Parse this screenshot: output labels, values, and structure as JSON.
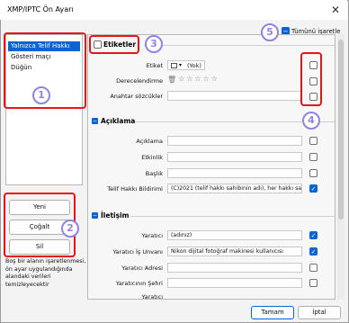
{
  "window": {
    "title": "XMP/IPTC Ön Ayarı"
  },
  "presets": [
    "Yalnızca Telif Hakkı",
    "Gösteri maçı",
    "Düğün"
  ],
  "side_buttons": {
    "new": "Yeni",
    "duplicate": "Çoğalt",
    "delete": "Sil"
  },
  "hint": "Boş bir alanın işaretlenmesi, ön ayar uygulandığında alandaki verileri temizleyecektir",
  "select_all": "Tümünü işaretle",
  "sections": {
    "labels": {
      "title": "Etiketler",
      "label_field": "Etiket",
      "label_value": "(Yok)",
      "rating_field": "Derecelendirme",
      "keywords_field": "Anahtar sözcükler"
    },
    "description": {
      "title": "Açıklama",
      "fields": [
        "Açıklama",
        "Etkinlik",
        "Başlık",
        "Telif Hakkı Bildirimi"
      ],
      "copyright_value": "(C)2021 (telif hakkı sahibinin adı), her hakkı sak"
    },
    "contact": {
      "title": "İletişim",
      "fields": [
        "Yaratıcı",
        "Yaratıcı İş Unvanı",
        "Yaratıcı Adresi",
        "Yaratıcının Şehri",
        "Yaratıcı"
      ],
      "creator_value": "(adınız)",
      "job_title_value": "Nikon dijital fotoğraf makinesi kullanıcısı"
    }
  },
  "footer": {
    "ok": "Tamam",
    "cancel": "İptal"
  },
  "annotations": [
    "1",
    "2",
    "3",
    "4",
    "5"
  ],
  "colors": {
    "accent": "#0a64d6",
    "annotation_red": "#e8141a",
    "badge": "#8e84e6"
  }
}
